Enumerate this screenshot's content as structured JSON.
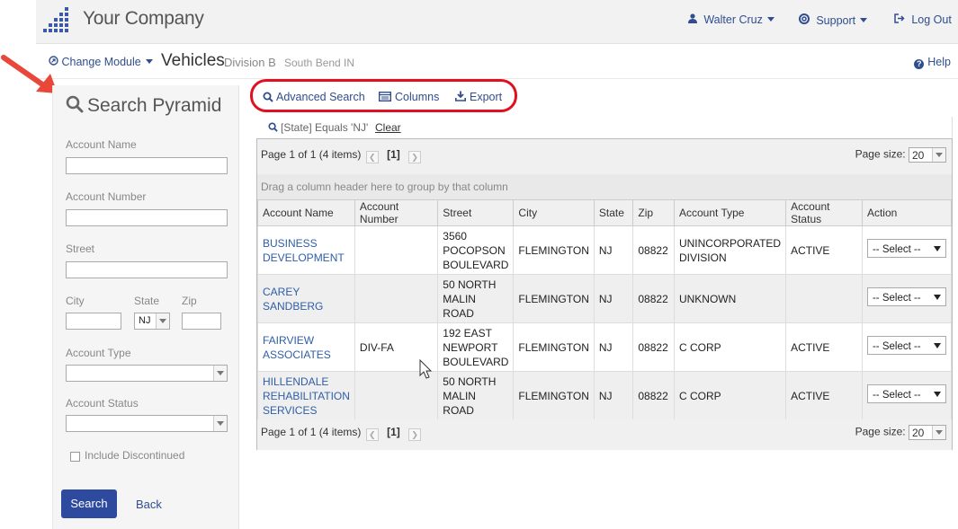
{
  "header": {
    "company": "Your Company",
    "user": "Walter Cruz",
    "support": "Support",
    "logout": "Log Out"
  },
  "subheader": {
    "change_module": "Change Module",
    "module": "Vehicles",
    "division": "Division B",
    "location": "South Bend IN",
    "help": "Help"
  },
  "sidebar": {
    "title": "Search Pyramid",
    "account_name_label": "Account Name",
    "account_number_label": "Account Number",
    "street_label": "Street",
    "city_label": "City",
    "state_label": "State",
    "state_value": "NJ",
    "zip_label": "Zip",
    "account_type_label": "Account Type",
    "account_status_label": "Account Status",
    "include_discontinued": "Include Discontinued",
    "search_button": "Search",
    "back_link": "Back"
  },
  "toolbar": {
    "advanced_search": "Advanced Search",
    "columns": "Columns",
    "export": "Export"
  },
  "filter": {
    "text": "[State] Equals 'NJ'",
    "clear": "Clear"
  },
  "grid": {
    "pager_text": "Page 1 of 1 (4 items)",
    "current_page": "[1]",
    "page_size_label": "Page size:",
    "page_size_value": "20",
    "group_hint": "Drag a column header here to group by that column",
    "columns": [
      "Account Name",
      "Account Number",
      "Street",
      "City",
      "State",
      "Zip",
      "Account Type",
      "Account Status",
      "Action"
    ],
    "rows": [
      {
        "name": "BUSINESS DEVELOPMENT",
        "number": "",
        "street": "3560 POCOPSON BOULEVARD",
        "city": "FLEMINGTON",
        "state": "NJ",
        "zip": "08822",
        "type": "UNINCORPORATED DIVISION",
        "status": "ACTIVE",
        "action": "-- Select --"
      },
      {
        "name": "CAREY SANDBERG",
        "number": "",
        "street": "50 NORTH MALIN ROAD",
        "city": "FLEMINGTON",
        "state": "NJ",
        "zip": "08822",
        "type": "UNKNOWN",
        "status": "",
        "action": "-- Select --"
      },
      {
        "name": "FAIRVIEW ASSOCIATES",
        "number": "DIV-FA",
        "street": "192 EAST NEWPORT BOULEVARD",
        "city": "FLEMINGTON",
        "state": "NJ",
        "zip": "08822",
        "type": "C CORP",
        "status": "ACTIVE",
        "action": "-- Select --"
      },
      {
        "name": "HILLENDALE REHABILITATION SERVICES",
        "number": "",
        "street": "50 NORTH MALIN ROAD",
        "city": "FLEMINGTON",
        "state": "NJ",
        "zip": "08822",
        "type": "C CORP",
        "status": "ACTIVE",
        "action": "-- Select --"
      }
    ]
  },
  "colors": {
    "link": "#2f4d8f",
    "primary_button": "#2e4a9e",
    "highlight": "#e01020",
    "arrow": "#e8473a"
  }
}
